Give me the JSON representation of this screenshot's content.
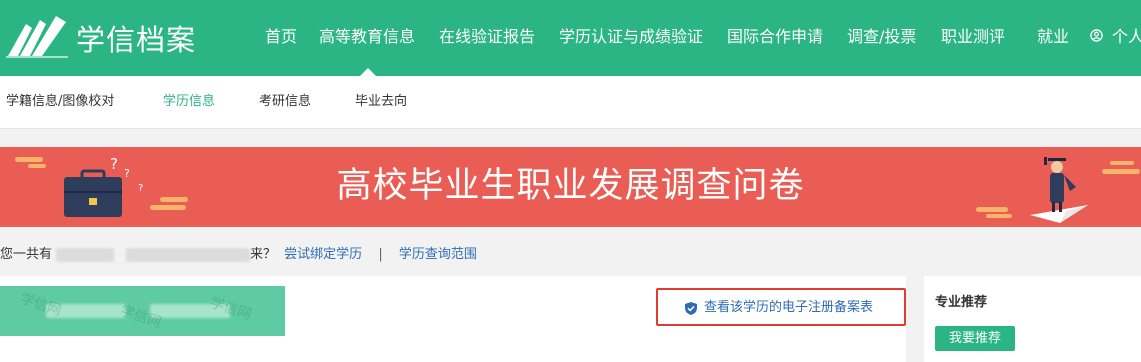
{
  "header": {
    "brand": "学信档案",
    "nav": [
      {
        "label": "首页"
      },
      {
        "label": "高等教育信息"
      },
      {
        "label": "在线验证报告"
      },
      {
        "label": "学历认证与成绩验证"
      },
      {
        "label": "国际合作申请"
      },
      {
        "label": "调查/投票"
      },
      {
        "label": "职业测评"
      },
      {
        "label": "就业"
      }
    ],
    "active_nav": "高等教育信息",
    "user_label": "个人"
  },
  "subnav": {
    "items": [
      {
        "label": "学籍信息/图像校对"
      },
      {
        "label": "学历信息"
      },
      {
        "label": "考研信息"
      },
      {
        "label": "毕业去向"
      }
    ],
    "active": "学历信息"
  },
  "banner": {
    "title": "高校毕业生职业发展调查问卷"
  },
  "info": {
    "prefix": "您一共有",
    "suffix": "来？",
    "bind_link": "尝试绑定学历",
    "separator": "|",
    "scope_link": "学历查询范围"
  },
  "record": {
    "watermark": "学信网",
    "button_label": "查看该学历的电子注册备案表"
  },
  "side": {
    "title": "专业推荐",
    "button_label": "我要推荐"
  },
  "colors": {
    "brand_green": "#2bb584",
    "banner_red": "#ea5d55",
    "link_blue": "#2e6db5",
    "highlight_red": "#e23b2f"
  }
}
